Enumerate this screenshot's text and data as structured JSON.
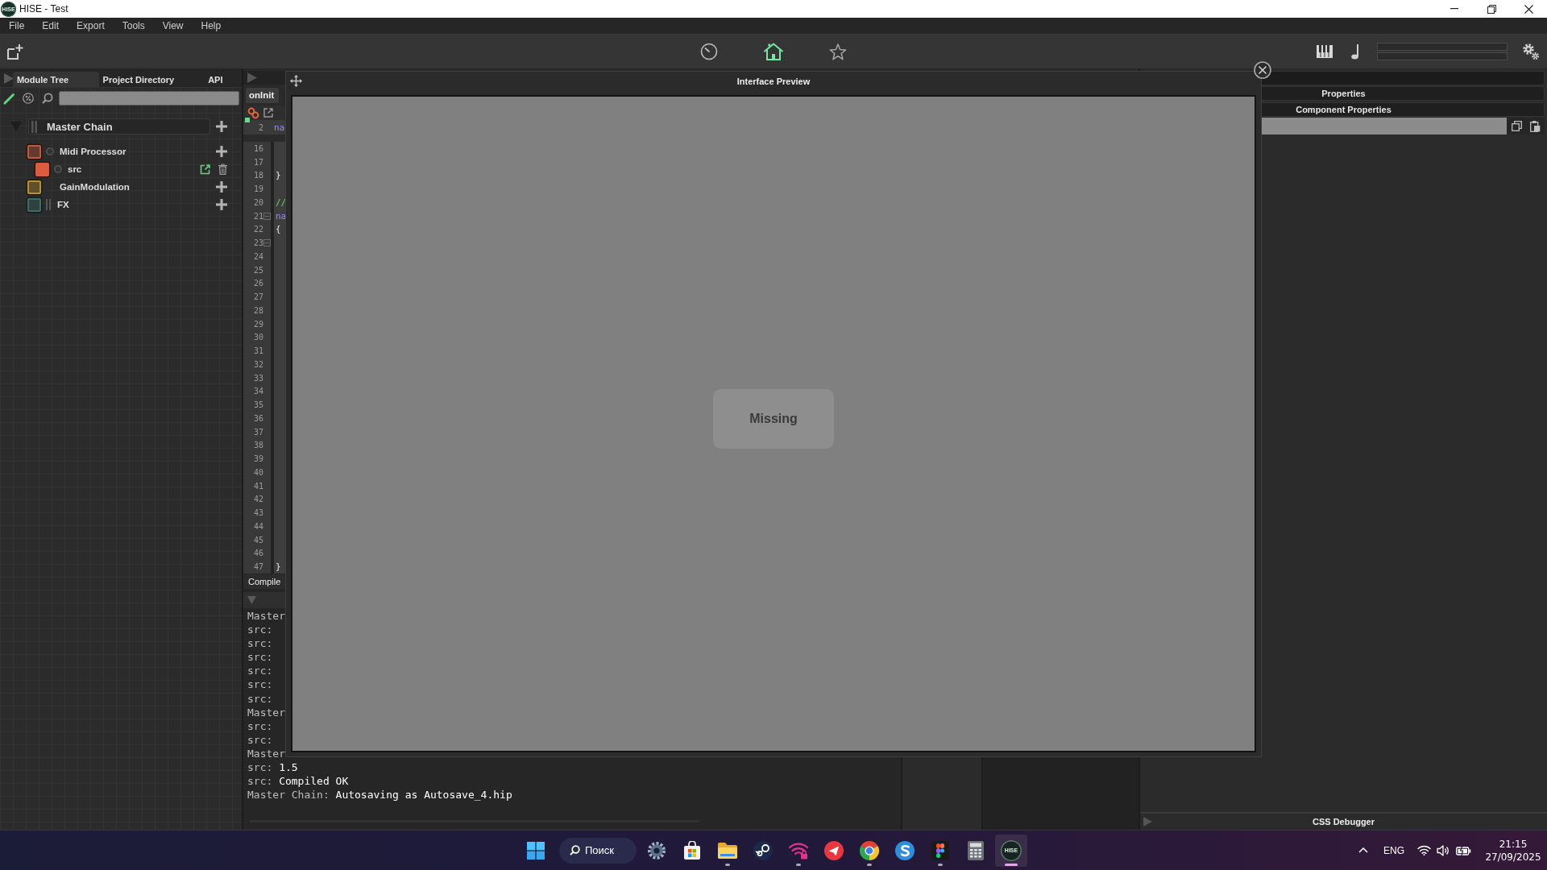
{
  "window": {
    "title": "HISE - Test",
    "logo_text": "HISE"
  },
  "menu": [
    "File",
    "Edit",
    "Export",
    "Tools",
    "View",
    "Help"
  ],
  "toolbar": {
    "views": [
      {
        "kind": "gauge",
        "selected": false
      },
      {
        "kind": "home",
        "selected": true
      },
      {
        "kind": "star",
        "selected": false
      }
    ]
  },
  "left_panel": {
    "tabs": [
      {
        "label": "Module Tree",
        "selected": true
      },
      {
        "label": "Project Directory",
        "selected": false
      },
      {
        "label": "API",
        "selected": false
      }
    ],
    "tree": {
      "label": "Master Chain",
      "expanded": true,
      "selected": false,
      "children": [
        {
          "label": "Midi Processor",
          "kind": "midi",
          "color": "#c4583c",
          "selected": false,
          "children": [
            {
              "label": "src",
              "kind": "script",
              "color": "#d95d3e",
              "selected": true
            }
          ]
        },
        {
          "label": "GainModulation",
          "kind": "modulation",
          "color": "#b8922e",
          "selected": false
        },
        {
          "label": "FX",
          "kind": "fx",
          "color": "#3e6d68",
          "selected": false
        }
      ]
    }
  },
  "code_editor": {
    "tab": "onInit",
    "pinned_line": {
      "number": "2",
      "text": "na",
      "kind": "keyword"
    },
    "lines": [
      {
        "number": "16",
        "fold": false
      },
      {
        "number": "17",
        "fold": false
      },
      {
        "number": "18",
        "fold": false,
        "text": "}",
        "kind": "plain"
      },
      {
        "number": "19",
        "fold": false
      },
      {
        "number": "20",
        "fold": false,
        "text": "//",
        "kind": "comment"
      },
      {
        "number": "21",
        "fold": true,
        "text": "na",
        "kind": "keyword"
      },
      {
        "number": "22",
        "fold": false,
        "text": "{",
        "kind": "plain"
      },
      {
        "number": "23",
        "fold": true
      },
      {
        "number": "24",
        "fold": false
      },
      {
        "number": "25",
        "fold": false
      },
      {
        "number": "26",
        "fold": false
      },
      {
        "number": "27",
        "fold": false
      },
      {
        "number": "28",
        "fold": false
      },
      {
        "number": "29",
        "fold": false
      },
      {
        "number": "30",
        "fold": false
      },
      {
        "number": "31",
        "fold": false
      },
      {
        "number": "32",
        "fold": false
      },
      {
        "number": "33",
        "fold": false
      },
      {
        "number": "34",
        "fold": false
      },
      {
        "number": "35",
        "fold": false
      },
      {
        "number": "36",
        "fold": false
      },
      {
        "number": "37",
        "fold": false
      },
      {
        "number": "38",
        "fold": false
      },
      {
        "number": "39",
        "fold": false
      },
      {
        "number": "40",
        "fold": false
      },
      {
        "number": "41",
        "fold": false
      },
      {
        "number": "42",
        "fold": false
      },
      {
        "number": "43",
        "fold": false
      },
      {
        "number": "44",
        "fold": false
      },
      {
        "number": "45",
        "fold": false
      },
      {
        "number": "46",
        "fold": false
      },
      {
        "number": "47",
        "fold": false,
        "text": "}",
        "kind": "plain"
      }
    ]
  },
  "console": {
    "tab": "Compile",
    "lines": [
      {
        "source": "Master"
      },
      {
        "source": "src:"
      },
      {
        "source": "src:"
      },
      {
        "source": "src:"
      },
      {
        "source": "src:"
      },
      {
        "source": "src:"
      },
      {
        "source": "src:"
      },
      {
        "source": "Master"
      },
      {
        "source": "src:"
      },
      {
        "source": "src:"
      },
      {
        "source": "Master"
      },
      {
        "source": "src:",
        "message": "1.5"
      },
      {
        "source": "src:",
        "message": "Compiled OK"
      },
      {
        "source": "Master Chain:",
        "message": "Autosaving as Autosave_4.hip"
      }
    ]
  },
  "interface_preview": {
    "title": "Interface Preview",
    "message": "Missing"
  },
  "properties": {
    "headers": [
      "Properties",
      "Component Properties"
    ]
  },
  "css_debugger": {
    "title": "CSS Debugger"
  },
  "taskbar": {
    "search_label": "Поиск",
    "apps": [
      {
        "kind": "gear",
        "running": false,
        "selected": false
      },
      {
        "kind": "bag",
        "running": false,
        "selected": false
      },
      {
        "kind": "folder",
        "running": true,
        "selected": false
      },
      {
        "kind": "disc",
        "running": false,
        "selected": false
      },
      {
        "kind": "wifi-lock",
        "running": true,
        "selected": false
      },
      {
        "kind": "plane",
        "running": false,
        "selected": false
      },
      {
        "kind": "ring",
        "running": true,
        "selected": false
      },
      {
        "kind": "swirl",
        "running": false,
        "selected": false
      },
      {
        "kind": "shapes",
        "running": true,
        "selected": false
      },
      {
        "kind": "calculator",
        "running": false,
        "selected": false
      },
      {
        "kind": "logo",
        "label": "HISE",
        "running": true,
        "selected": true
      }
    ],
    "tray": {
      "language": "ENG",
      "time": "21:15",
      "date": "27/09/2025"
    }
  }
}
